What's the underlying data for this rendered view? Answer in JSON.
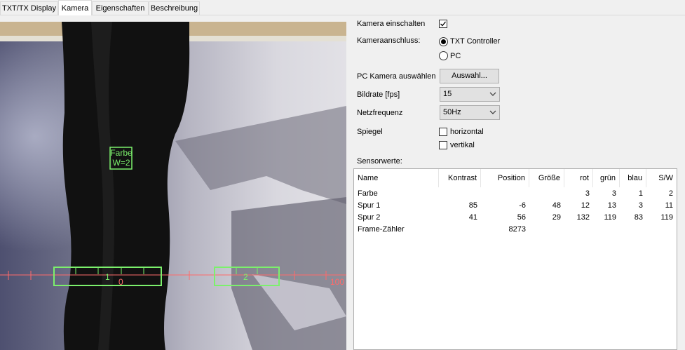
{
  "tabs": [
    "TXT/TX Display",
    "Kamera",
    "Eigenschaften",
    "Beschreibung"
  ],
  "camera_view": {
    "overlay_color": "#7cf06c",
    "scale_color": "#ff6a6a",
    "color_detector": {
      "line1": "Farbe",
      "line2": "W=2"
    },
    "track_1": {
      "label": "1",
      "scale_label": "0"
    },
    "track_2": {
      "label": "2"
    },
    "scale_end_label": "100"
  },
  "settings": {
    "enable_camera_label": "Kamera einschalten",
    "enable_camera_checked": true,
    "connection_label": "Kameraanschluss:",
    "connection_options": [
      "TXT Controller",
      "PC"
    ],
    "connection_selected": "TXT Controller",
    "pc_camera_label": "PC Kamera auswählen",
    "pc_camera_button": "Auswahl...",
    "framerate_label": "Bildrate [fps]",
    "framerate_value": "15",
    "netfreq_label": "Netzfrequenz",
    "netfreq_value": "50Hz",
    "mirror_label": "Spiegel",
    "mirror_horizontal_label": "horizontal",
    "mirror_horizontal_checked": false,
    "mirror_vertical_label": "vertikal",
    "mirror_vertical_checked": false,
    "sensor_values_label": "Sensorwerte:"
  },
  "sensor_table": {
    "columns": [
      "Name",
      "Kontrast",
      "Position",
      "Größe",
      "rot",
      "grün",
      "blau",
      "S/W"
    ],
    "rows": [
      [
        "Farbe",
        "",
        "",
        "",
        "3",
        "3",
        "1",
        "2"
      ],
      [
        "Spur 1",
        "85",
        "-6",
        "48",
        "12",
        "13",
        "3",
        "11"
      ],
      [
        "Spur 2",
        "41",
        "56",
        "29",
        "132",
        "119",
        "83",
        "119"
      ],
      [
        "Frame-Zähler",
        "",
        "8273",
        "",
        "",
        "",
        "",
        ""
      ]
    ]
  }
}
